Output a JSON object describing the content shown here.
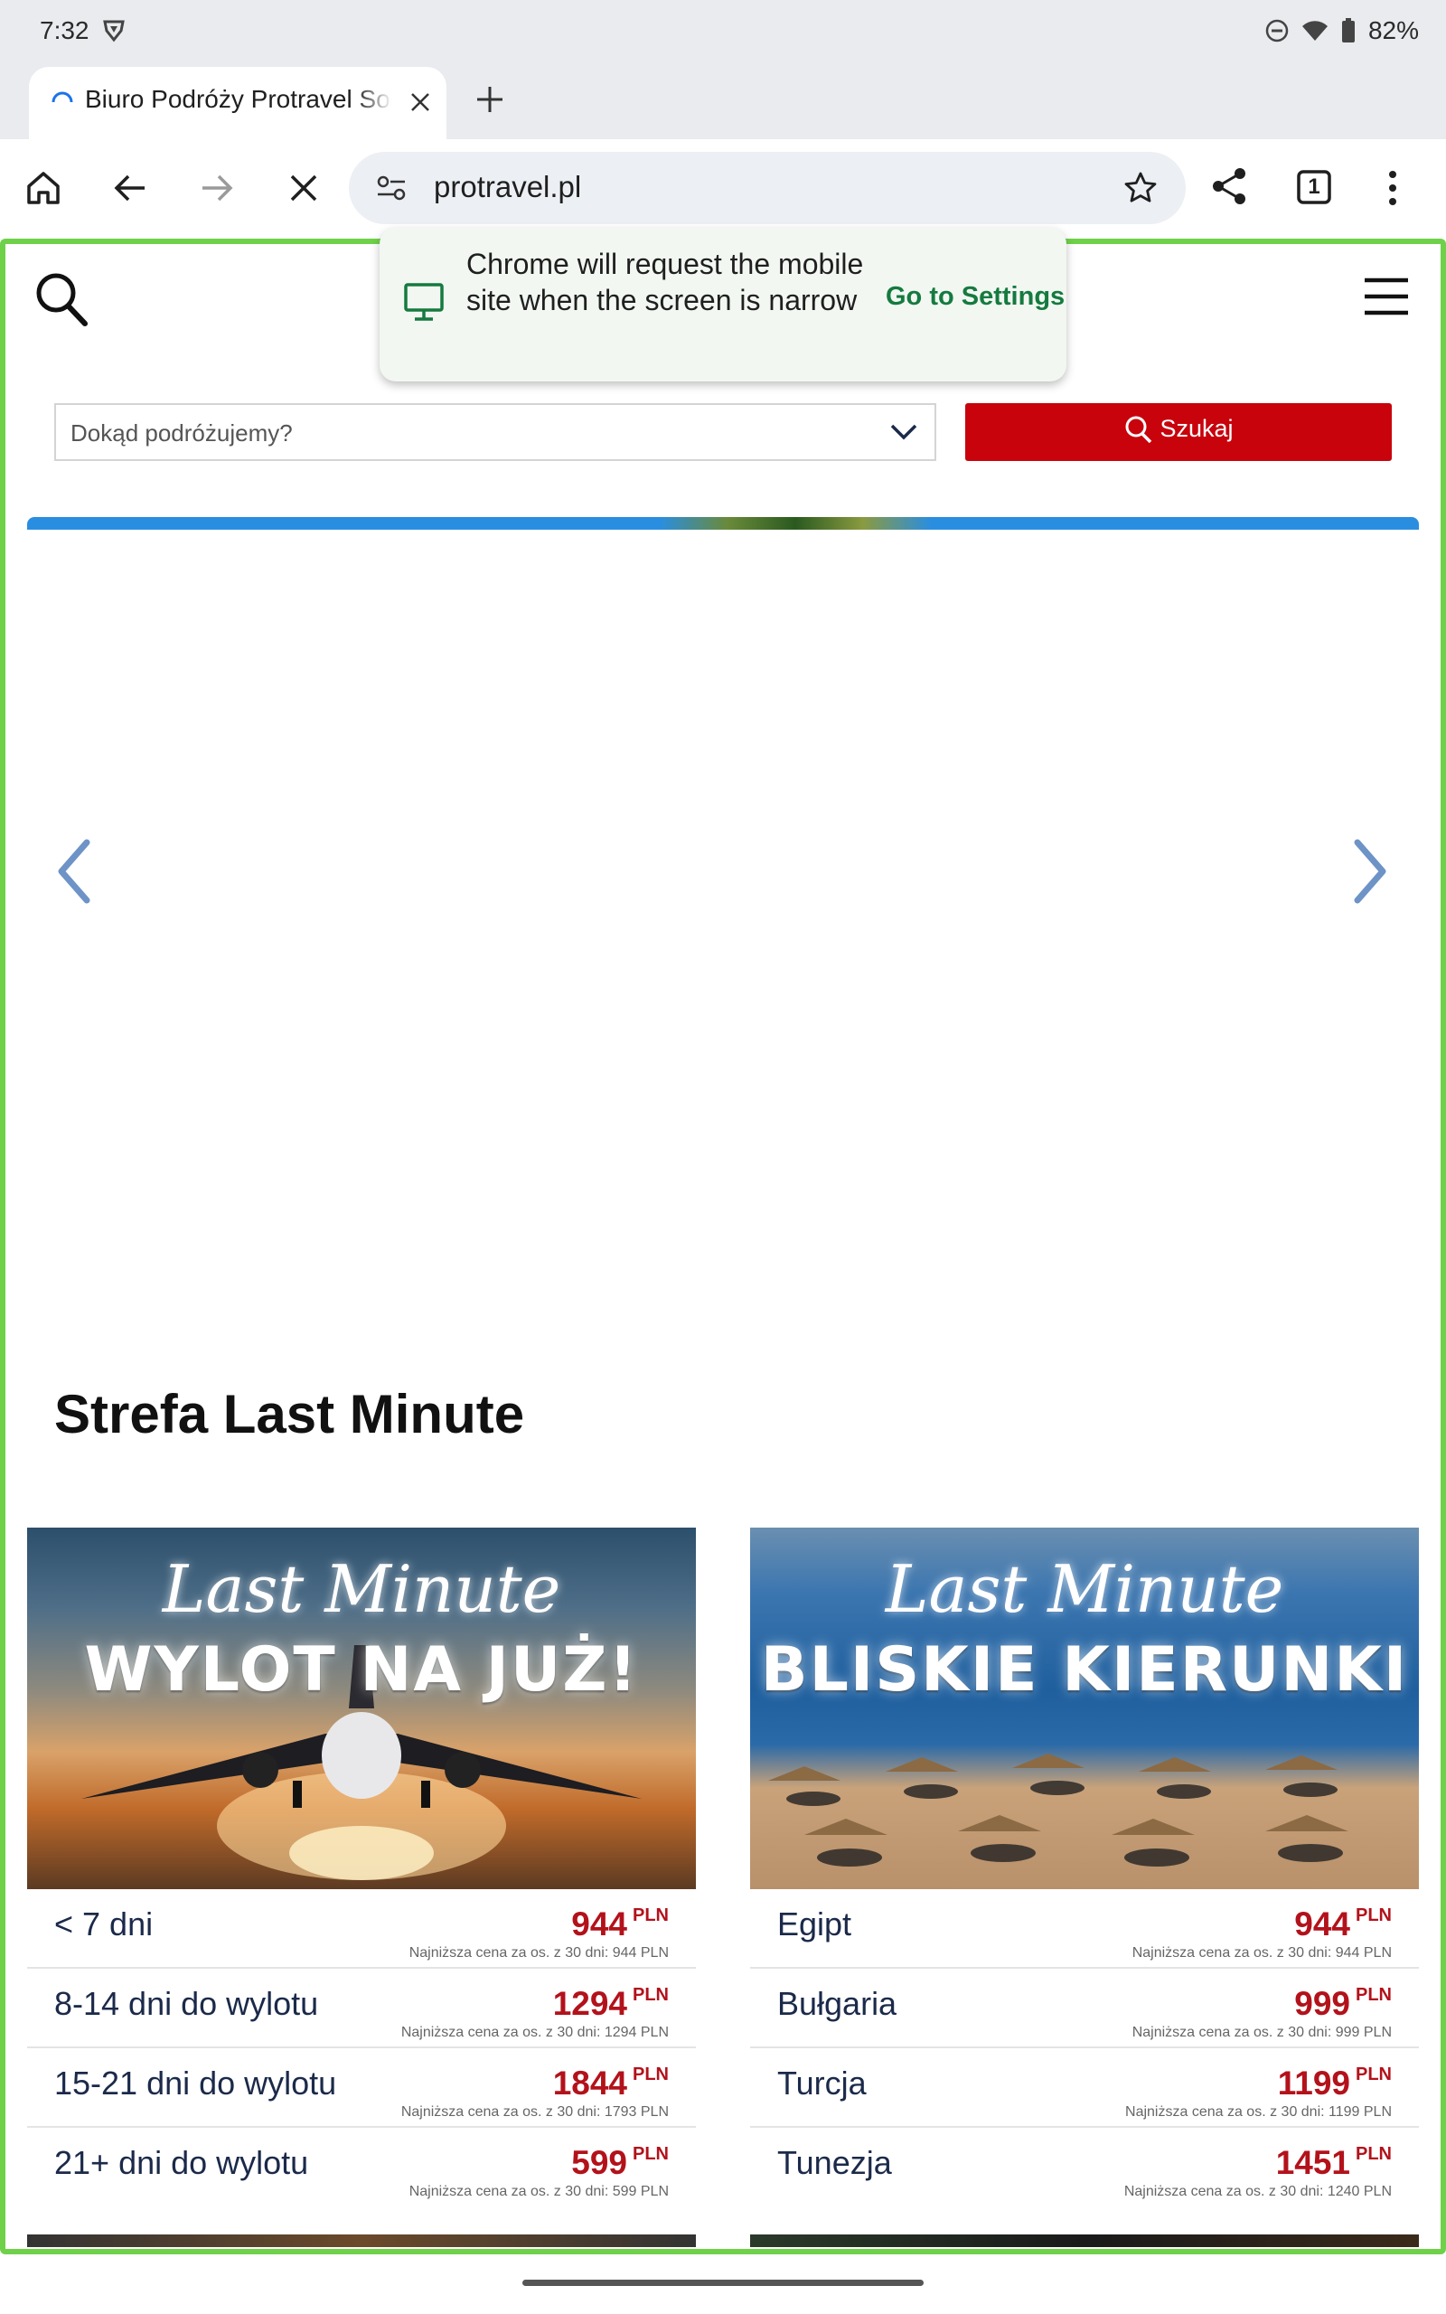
{
  "status_bar": {
    "time": "7:32",
    "battery": "82%"
  },
  "tab": {
    "title": "Biuro Podróży Protravel Social",
    "close_icon": "close-icon"
  },
  "toolbar": {
    "url": "protravel.pl"
  },
  "tab_count": "1",
  "popup": {
    "message": "Chrome will request the mobile site when the screen is narrow",
    "action": "Go to Settings"
  },
  "search": {
    "placeholder": "Dokąd podróżujemy?",
    "button": "Szukaj"
  },
  "section_title": "Strefa Last Minute",
  "cards": [
    {
      "script": "Last Minute",
      "headline": "WYLOT NA JUŻ!",
      "rows": [
        {
          "label": "< 7 dni",
          "price": "944",
          "currency": "PLN",
          "note": "Najniższa cena za os. z 30 dni: 944 PLN"
        },
        {
          "label": "8-14 dni do wylotu",
          "price": "1294",
          "currency": "PLN",
          "note": "Najniższa cena za os. z 30 dni: 1294 PLN"
        },
        {
          "label": "15-21 dni do wylotu",
          "price": "1844",
          "currency": "PLN",
          "note": "Najniższa cena za os. z 30 dni: 1793 PLN"
        },
        {
          "label": "21+ dni do wylotu",
          "price": "599",
          "currency": "PLN",
          "note": "Najniższa cena za os. z 30 dni: 599 PLN"
        }
      ]
    },
    {
      "script": "Last Minute",
      "headline": "BLISKIE KIERUNKI",
      "rows": [
        {
          "label": "Egipt",
          "price": "944",
          "currency": "PLN",
          "note": "Najniższa cena za os. z 30 dni: 944 PLN"
        },
        {
          "label": "Bułgaria",
          "price": "999",
          "currency": "PLN",
          "note": "Najniższa cena za os. z 30 dni: 999 PLN"
        },
        {
          "label": "Turcja",
          "price": "1199",
          "currency": "PLN",
          "note": "Najniższa cena za os. z 30 dni: 1199 PLN"
        },
        {
          "label": "Tunezja",
          "price": "1451",
          "currency": "PLN",
          "note": "Najniższa cena za os. z 30 dni: 1240 PLN"
        }
      ]
    }
  ],
  "colors": {
    "accent_red": "#c8030c",
    "price_red": "#b3121b",
    "frame_green": "#6fd14a",
    "link_green": "#157a3f"
  }
}
